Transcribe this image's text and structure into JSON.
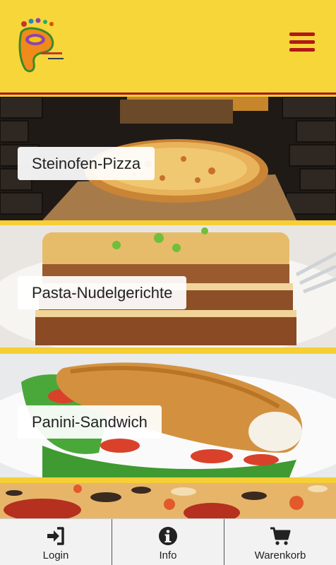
{
  "header": {
    "logo_name": "pizza-pia-logo",
    "menu_icon": "hamburger-icon",
    "accent_color": "#b11818",
    "background_color": "#f7d63a"
  },
  "categories": [
    {
      "label": "Steinofen-Pizza"
    },
    {
      "label": "Pasta-Nudelgerichte"
    },
    {
      "label": "Panini-Sandwich"
    }
  ],
  "tabbar": {
    "tabs": [
      {
        "label": "Login",
        "icon": "login-icon"
      },
      {
        "label": "Info",
        "icon": "info-icon"
      },
      {
        "label": "Warenkorb",
        "icon": "cart-icon"
      }
    ]
  }
}
